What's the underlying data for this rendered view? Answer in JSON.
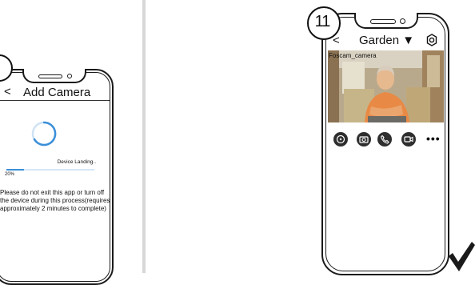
{
  "left_screen": {
    "back_label": "<",
    "title": "Add Camera",
    "status_text": "Device Landing..",
    "progress_percent": 20,
    "progress_label": "20%",
    "warning_text": "Please do not exit this app or turn off the device during this process(requires approximately 2 minutes to complete)"
  },
  "right_screen": {
    "step_number": "11",
    "back_label": "<",
    "title": "Garden ▼",
    "settings_icon": "gear-icon",
    "camera_name": "Foscam_camera",
    "controls": [
      "snapshot-icon",
      "camera-icon",
      "phone-icon",
      "record-icon"
    ],
    "more_label": "•••"
  },
  "colors": {
    "progress": "#3b8fd8",
    "controls": "#2e2e2e"
  }
}
